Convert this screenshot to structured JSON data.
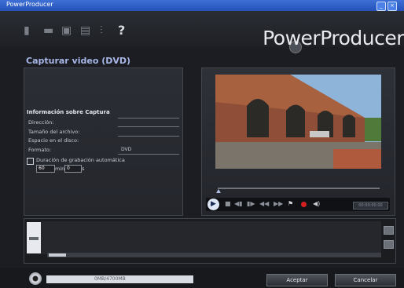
{
  "window": {
    "title": "PowerProducer"
  },
  "brand": {
    "name": "PowerProducer"
  },
  "toolbar": {
    "help_label": "?"
  },
  "page": {
    "heading": "Capturar video (DVD)"
  },
  "capture_info": {
    "title": "Información sobre Captura",
    "fields": [
      {
        "label": "Dirección:"
      },
      {
        "label": "Tamaño del archivo:"
      },
      {
        "label": "Espacio en el disco:"
      },
      {
        "label": "Formato:",
        "value": "DVD"
      }
    ],
    "auto_stop": {
      "label": "Duración de grabación automática",
      "minutes": "60",
      "min_label": "min",
      "seconds": "0",
      "s_label": "s"
    }
  },
  "player": {
    "vol_label": "◀)",
    "info_text": "00:00:00:00"
  },
  "status": {
    "capacity_text": "0MB/4700MB"
  },
  "buttons": {
    "accept": "Aceptar",
    "cancel": "Cancelar"
  },
  "colors": {
    "titlebar": "#2f62c9",
    "heading": "#a7b6e6",
    "record": "#d42020"
  }
}
